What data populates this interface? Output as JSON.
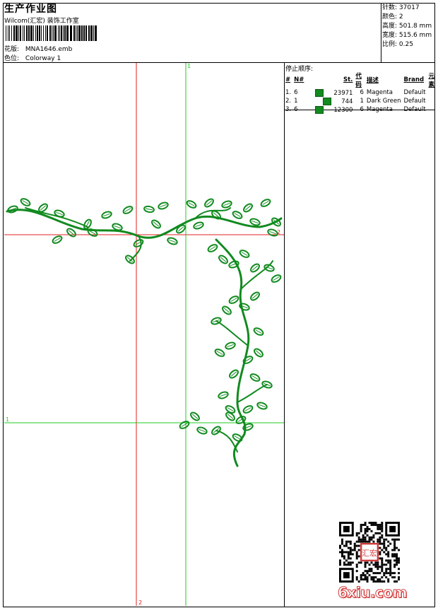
{
  "header": {
    "title": "生产作业图",
    "company": "Wilcom(汇宏) 装饰工作室",
    "design_label": "花版:",
    "design_value": "MNA1646.emb",
    "colorway_label": "色位:",
    "colorway_value": "Colorway 1"
  },
  "stats": {
    "stitches_label": "针数:",
    "stitches_value": "37017",
    "colors_label": "颜色:",
    "colors_value": "2",
    "height_label": "高度:",
    "height_value": "501.8 mm",
    "width_label": "宽度:",
    "width_value": "515.6 mm",
    "scale_label": "比例:",
    "scale_value": "0.25"
  },
  "stop_sequence": {
    "title": "停止顺序:",
    "columns": [
      "#",
      "N#",
      "St.",
      "代码",
      "描述",
      "Brand",
      "元素"
    ],
    "rows": [
      {
        "idx": "1.",
        "n": "6",
        "swatch": "#118a1f",
        "st": "23971",
        "code": "6",
        "desc": "Magenta",
        "brand": "Default"
      },
      {
        "idx": "2.",
        "n": "1",
        "swatch": "#118a1f",
        "st": "744",
        "code": "1",
        "desc": "Dark Green",
        "brand": "Default"
      },
      {
        "idx": "3.",
        "n": "6",
        "swatch": "#118a1f",
        "st": "12300",
        "code": "6",
        "desc": "Magenta",
        "brand": "Default"
      }
    ]
  },
  "canvas": {
    "marker_top": "1",
    "marker_right": "2",
    "marker_left": "1",
    "marker_bottom": "2",
    "guide_red": "#e02020",
    "guide_green": "#22cc22",
    "stitch_color": "#118a1f"
  },
  "watermark": {
    "text": "6xiu.com",
    "seal_text": "汇宏"
  }
}
